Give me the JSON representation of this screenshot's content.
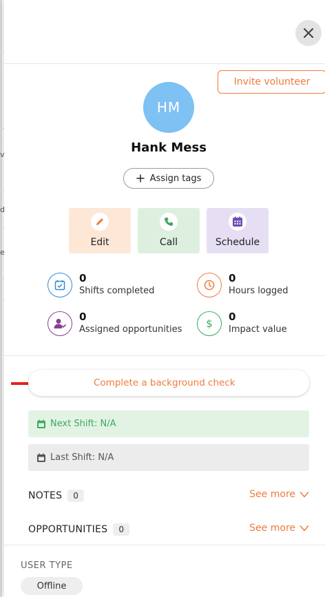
{
  "background": {
    "fragments": [
      "ve",
      "d",
      "e"
    ]
  },
  "header": {
    "close_icon": "close-icon"
  },
  "invite_label": "Invite volunteer",
  "profile": {
    "initials": "HM",
    "name": "Hank Mess",
    "avatar_color": "#7ec1f3"
  },
  "assign_tags_label": "Assign tags",
  "actions": [
    {
      "label": "Edit",
      "icon": "pencil-icon",
      "bg": "#fde8d8",
      "color": "#f07a3d"
    },
    {
      "label": "Call",
      "icon": "phone-icon",
      "bg": "#ddf0e0",
      "color": "#3caa5c"
    },
    {
      "label": "Schedule",
      "icon": "calendar-icon",
      "bg": "#e6dff3",
      "color": "#6e4fb4"
    }
  ],
  "stats": [
    {
      "value": "0",
      "label": "Shifts completed",
      "icon": "calendar-check-icon",
      "color": "#2e8ad8"
    },
    {
      "value": "0",
      "label": "Hours logged",
      "icon": "clock-icon",
      "color": "#f07a3d"
    },
    {
      "value": "0",
      "label": "Assigned opportunities",
      "icon": "user-check-icon",
      "color": "#8b3d96"
    },
    {
      "value": "0",
      "label": "Impact value",
      "icon": "dollar-icon",
      "color": "#3caa5c"
    }
  ],
  "background_check_label": "Complete a background check",
  "next_shift": {
    "label": "Next Shift: N/A",
    "bg": "#e2f3e4",
    "color": "#3caa5c"
  },
  "last_shift": {
    "label": "Last Shift: N/A",
    "bg": "#ececec",
    "color": "#555555"
  },
  "sections": [
    {
      "title": "NOTES",
      "count": "0",
      "more": "See more"
    },
    {
      "title": "OPPORTUNITIES",
      "count": "0",
      "more": "See more"
    }
  ],
  "user_type": {
    "title": "USER TYPE",
    "value": "Offline"
  },
  "accent_color": "#f07a3d"
}
